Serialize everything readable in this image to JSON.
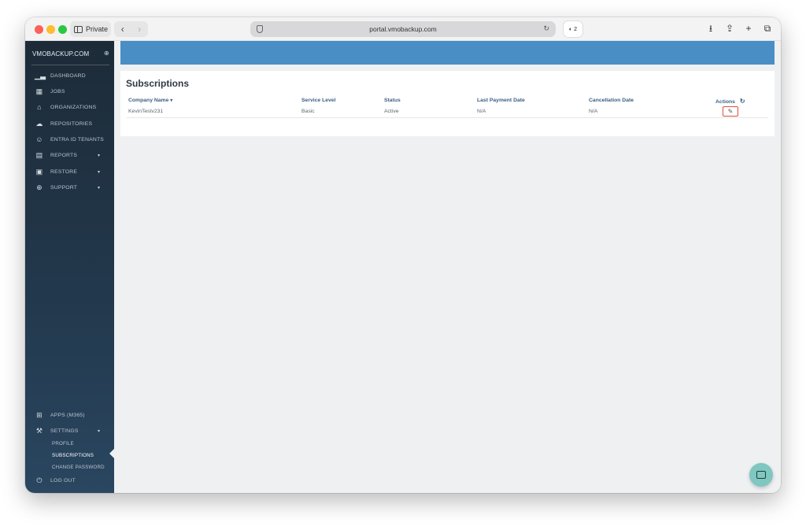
{
  "browser": {
    "private_label": "Private",
    "url": "portal.vmobackup.com",
    "extension_badge": "2"
  },
  "sidebar": {
    "brand": "VMOBACKUP.COM",
    "items": [
      {
        "label": "DASHBOARD",
        "icon": "bar-chart-icon"
      },
      {
        "label": "JOBS",
        "icon": "grid-icon"
      },
      {
        "label": "ORGANIZATIONS",
        "icon": "bank-icon"
      },
      {
        "label": "REPOSITORIES",
        "icon": "cloud-upload-icon"
      },
      {
        "label": "ENTRA ID TENANTS",
        "icon": "user-icon"
      },
      {
        "label": "REPORTS",
        "icon": "report-icon"
      },
      {
        "label": "RESTORE",
        "icon": "restore-icon"
      },
      {
        "label": "SUPPORT",
        "icon": "globe-icon"
      }
    ],
    "bottom_items": [
      {
        "label": "APPS (M365)",
        "icon": "apps-icon"
      },
      {
        "label": "SETTINGS",
        "icon": "tools-icon"
      }
    ],
    "settings_sub": [
      "PROFILE",
      "SUBSCRIPTIONS",
      "CHANGE PASSWORD"
    ],
    "logout": "LOG OUT"
  },
  "main": {
    "title": "Subscriptions",
    "columns": [
      "Company Name",
      "Service Level",
      "Status",
      "Last Payment Date",
      "Cancellation Date",
      "Actions"
    ],
    "rows": [
      {
        "company": "KevinTestv231",
        "service_level": "Basic",
        "status": "Active",
        "last_payment": "N/A",
        "cancellation": "N/A"
      }
    ]
  },
  "colors": {
    "sidebar_bg": "#1d2b38",
    "banner": "#4a8ec6",
    "header_text": "#3a5f82",
    "edit_highlight": "#e04d3c",
    "chat_fab": "#7fc7c0"
  }
}
